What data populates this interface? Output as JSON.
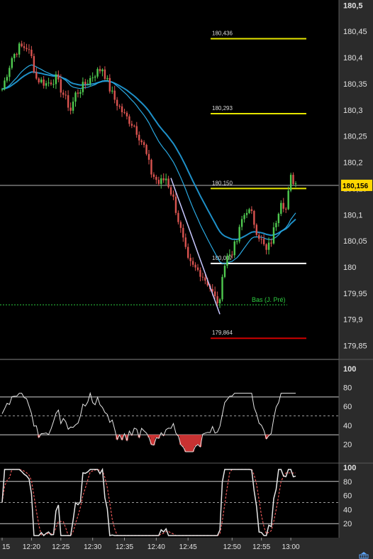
{
  "chart_data": [
    {
      "type": "candlestick",
      "price_axis": {
        "range": [
          179.825,
          180.51
        ],
        "ticks": [
          {
            "v": 180.5,
            "label": "180,5"
          },
          {
            "v": 180.45,
            "label": "180,45"
          },
          {
            "v": 180.4,
            "label": "180,4"
          },
          {
            "v": 180.35,
            "label": "180,35"
          },
          {
            "v": 180.3,
            "label": "180,3"
          },
          {
            "v": 180.25,
            "label": "180,25"
          },
          {
            "v": 180.2,
            "label": "180,2"
          },
          {
            "v": 180.15,
            "label": "180,15"
          },
          {
            "v": 180.1,
            "label": "180,1"
          },
          {
            "v": 180.05,
            "label": "180,05"
          },
          {
            "v": 180.0,
            "label": "180"
          },
          {
            "v": 179.95,
            "label": "179,95"
          },
          {
            "v": 179.9,
            "label": "179,9"
          },
          {
            "v": 179.85,
            "label": "179,85"
          }
        ]
      },
      "current_price": {
        "value": 180.156,
        "label": "180,156",
        "color": "#ffd700"
      },
      "levels": [
        {
          "label": "180,436",
          "value": 180.436,
          "color": "#e5e500"
        },
        {
          "label": "180,293",
          "value": 180.293,
          "color": "#e5e500"
        },
        {
          "label": "180,150",
          "value": 180.15,
          "color": "#e5e500"
        },
        {
          "label": "180,007",
          "value": 180.007,
          "color": "#ffffff"
        },
        {
          "label": "179,864",
          "value": 179.864,
          "color": "#d00000"
        }
      ],
      "prev_low": {
        "label": "Bas (J. Pré)",
        "value": 179.928,
        "color": "#2ecc40"
      },
      "trendline": {
        "start": {
          "bar": 69,
          "price": 180.17
        },
        "end": {
          "bar": 89,
          "price": 179.91
        },
        "color": "#c8c8ff"
      },
      "x_axis_labels": [
        {
          "bar": 0,
          "label": "15"
        },
        {
          "bar": 12,
          "label": "12:20"
        },
        {
          "bar": 24,
          "label": "12:25"
        },
        {
          "bar": 37,
          "label": "12:30"
        },
        {
          "bar": 50,
          "label": "12:35"
        },
        {
          "bar": 63,
          "label": "12:40"
        },
        {
          "bar": 76,
          "label": "12:45"
        },
        {
          "bar": 94,
          "label": "12:50"
        },
        {
          "bar": 106,
          "label": "12:55"
        },
        {
          "bar": 118,
          "label": "13:00"
        }
      ],
      "up_color": "#4fc94f",
      "down_color": "#d9534f",
      "ma_fast_color": "#2aa8e0",
      "ma_slow_color": "#1e90c8"
    },
    {
      "type": "line",
      "name": "oscillator-1",
      "range": [
        0,
        100
      ],
      "ticks": [
        {
          "v": 100,
          "label": "100"
        },
        {
          "v": 80,
          "label": "80"
        },
        {
          "v": 60,
          "label": "60"
        },
        {
          "v": 40,
          "label": "40"
        },
        {
          "v": 20,
          "label": "20"
        }
      ],
      "upper_level": 70,
      "lower_level": 30,
      "mid_level": 50,
      "oversold_fill": "#c83232"
    },
    {
      "type": "line",
      "name": "oscillator-2",
      "range": [
        0,
        100
      ],
      "ticks": [
        {
          "v": 100,
          "label": "100"
        },
        {
          "v": 80,
          "label": "80"
        },
        {
          "v": 60,
          "label": "60"
        },
        {
          "v": 40,
          "label": "40"
        },
        {
          "v": 20,
          "label": "20"
        }
      ],
      "upper_level": 80,
      "lower_level": 20,
      "mid_level": 50,
      "main_color": "#e6e6e6",
      "signal_color": "#e05555"
    }
  ]
}
